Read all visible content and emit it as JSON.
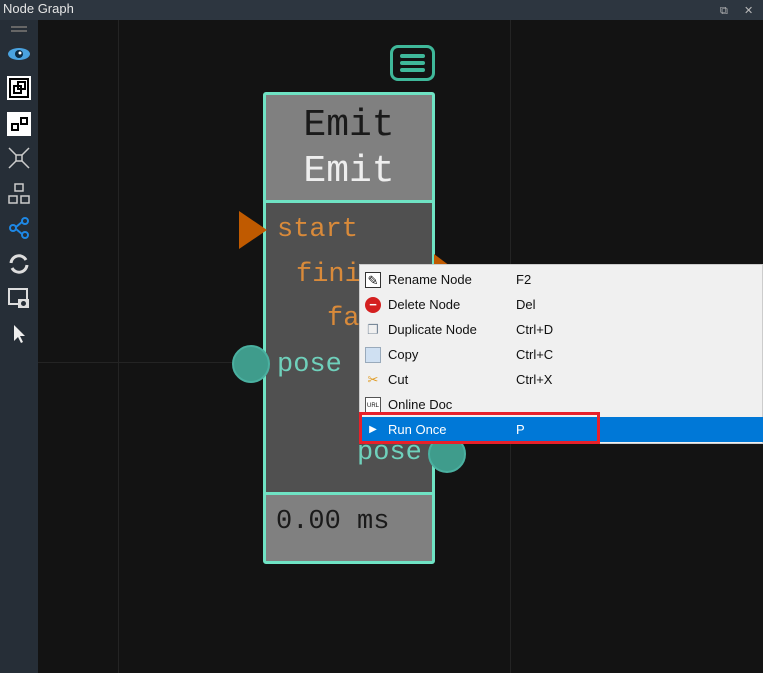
{
  "window": {
    "title": "Node Graph",
    "float_icon": "restore-icon",
    "close_icon": "close-icon"
  },
  "toolbar": [
    "drag-handle-icon",
    "eye-icon",
    "group-icon",
    "ungroup-icon",
    "collapse-icon",
    "layout-icon",
    "share-icon",
    "refresh-icon",
    "screenshot-icon",
    "pointer-icon"
  ],
  "node": {
    "title": "Emit",
    "subtitle": "Emit",
    "inputs": [
      "start",
      "pose"
    ],
    "outputs": [
      "fini",
      "fa",
      "pose"
    ],
    "timing": "0.00 ms",
    "border_color": "#6fe3c4",
    "exec_port_color": "#c05a00",
    "data_port_color": "#3f9c8c"
  },
  "context_menu": {
    "items": [
      {
        "label": "Rename Node",
        "shortcut": "F2",
        "icon": "rename-icon"
      },
      {
        "label": "Delete Node",
        "shortcut": "Del",
        "icon": "delete-icon"
      },
      {
        "label": "Duplicate Node",
        "shortcut": "Ctrl+D",
        "icon": "duplicate-icon"
      },
      {
        "label": "Copy",
        "shortcut": "Ctrl+C",
        "icon": "copy-icon"
      },
      {
        "label": "Cut",
        "shortcut": "Ctrl+X",
        "icon": "cut-icon"
      },
      {
        "label": "Online Doc",
        "shortcut": "",
        "icon": "url-doc-icon"
      },
      {
        "label": "Run Once",
        "shortcut": "P",
        "icon": "play-icon",
        "highlighted": true
      }
    ],
    "highlight_color": "#0078d7"
  }
}
